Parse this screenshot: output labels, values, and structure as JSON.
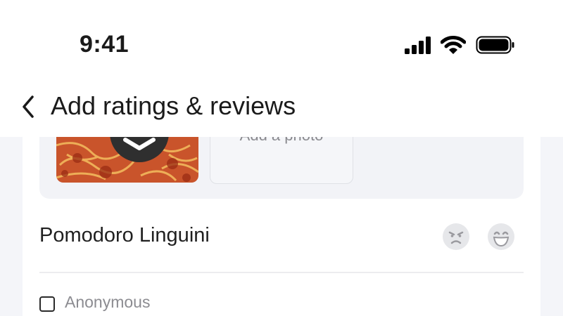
{
  "status_bar": {
    "time": "9:41",
    "icons": [
      "signal-icon",
      "wifi-icon",
      "battery-icon"
    ]
  },
  "header": {
    "back_icon": "chevron-left-icon",
    "title": "Add ratings & reviews"
  },
  "photos": {
    "add_photo_label": "Add a photo"
  },
  "item": {
    "name": "Pomodoro Linguini",
    "rating_options": [
      "angry-face-icon",
      "laughing-face-icon"
    ]
  },
  "anonymous": {
    "label": "Anonymous",
    "checked": false
  },
  "colors": {
    "background": "#f4f5f9",
    "surface": "#ffffff",
    "muted_text": "#8c8c91"
  }
}
